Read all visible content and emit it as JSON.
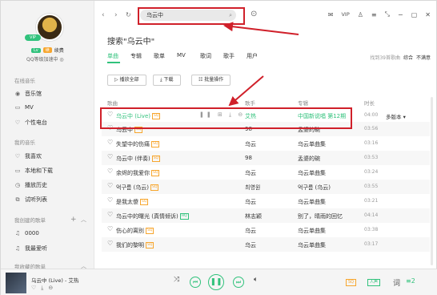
{
  "sidebar": {
    "vip_badge": "VIP",
    "level_badge": "Lv",
    "level2_badge": "续",
    "renew_label": "续费",
    "user_sub": "QQ等级加速中 ◎",
    "online_title": "在线音乐",
    "online_items": [
      {
        "icon": "music-hall-icon",
        "glyph": "◉",
        "label": "音乐馆"
      },
      {
        "icon": "mv-icon",
        "glyph": "▭",
        "label": "MV"
      },
      {
        "icon": "radio-icon",
        "glyph": "♡",
        "label": "个性电台"
      }
    ],
    "my_title": "我的音乐",
    "my_items": [
      {
        "icon": "heart-icon",
        "glyph": "♡",
        "label": "我喜欢"
      },
      {
        "icon": "local-icon",
        "glyph": "▭",
        "label": "本地和下载"
      },
      {
        "icon": "history-icon",
        "glyph": "◷",
        "label": "播放历史"
      },
      {
        "icon": "audition-icon",
        "glyph": "⧉",
        "label": "试听列表"
      }
    ],
    "created_title": "我创建的歌单",
    "created_items": [
      {
        "icon": "playlist-icon",
        "glyph": "♫",
        "label": "0000"
      },
      {
        "icon": "playlist-icon",
        "glyph": "♫",
        "label": "我最爱听"
      }
    ],
    "collected_title": "我收藏的歌单"
  },
  "topbar": {
    "search_value": "乌云中",
    "vip": "VIP"
  },
  "content": {
    "search_title": "搜索\"乌云中\"",
    "tabs": [
      "单曲",
      "专辑",
      "歌单",
      "MV",
      "歌词",
      "歌手",
      "用户"
    ],
    "found_text": "找到39首歌曲",
    "sort_relevance": "综合",
    "sort_new": "不满意",
    "play_all": "▷ 播放全部",
    "download": "⤓ 下载",
    "batch": "☷ 批量操作",
    "col_song": "歌曲",
    "col_singer": "歌手",
    "col_album": "专辑",
    "col_duration": "时长",
    "multi_version": "多版本 ▾",
    "rows": [
      {
        "title": "乌云中 (Live)",
        "badge": "SQ",
        "singer": "艾热",
        "album": "中国新说唱 第12期",
        "duration": "04:00",
        "highlight": true
      },
      {
        "title": "乌云中",
        "badge": "SQ",
        "singer": "98",
        "album": "孟婆的碗",
        "duration": "03:56"
      },
      {
        "title": "失望中的伤痛",
        "badge": "SQ",
        "singer": "乌云",
        "album": "乌云单曲集",
        "duration": "03:16"
      },
      {
        "title": "乌云中 (伴奏)",
        "badge": "SQ",
        "singer": "98",
        "album": "孟婆的碗",
        "duration": "03:53"
      },
      {
        "title": "余烬的我爱你",
        "badge": "SQ",
        "singer": "乌云",
        "album": "乌云单曲集",
        "duration": "03:24"
      },
      {
        "title": "억구름 (乌云)",
        "badge": "SQ",
        "singer": "최영원",
        "album": "억구름 (乌云)",
        "duration": "03:55"
      },
      {
        "title": "是我太傻",
        "badge": "SQ",
        "singer": "乌云",
        "album": "乌云单曲集",
        "duration": "03:21"
      },
      {
        "title": "乌云中的曙光 (真情倾诉)",
        "badge": "HQ",
        "singer": "林志颖",
        "album": "别了，晴雨的回忆",
        "duration": "04:14"
      },
      {
        "title": "伤心的离别",
        "badge": "SQ",
        "singer": "乌云",
        "album": "乌云单曲集",
        "duration": "03:38"
      },
      {
        "title": "我们的黎明",
        "badge": "SQ",
        "singer": "乌云",
        "album": "乌云单曲集",
        "duration": "03:17"
      }
    ]
  },
  "player": {
    "now_title": "乌云中 (Live) - 艾热",
    "quality": "SQ",
    "effect": "人声",
    "lyric": "词",
    "count": "2"
  }
}
